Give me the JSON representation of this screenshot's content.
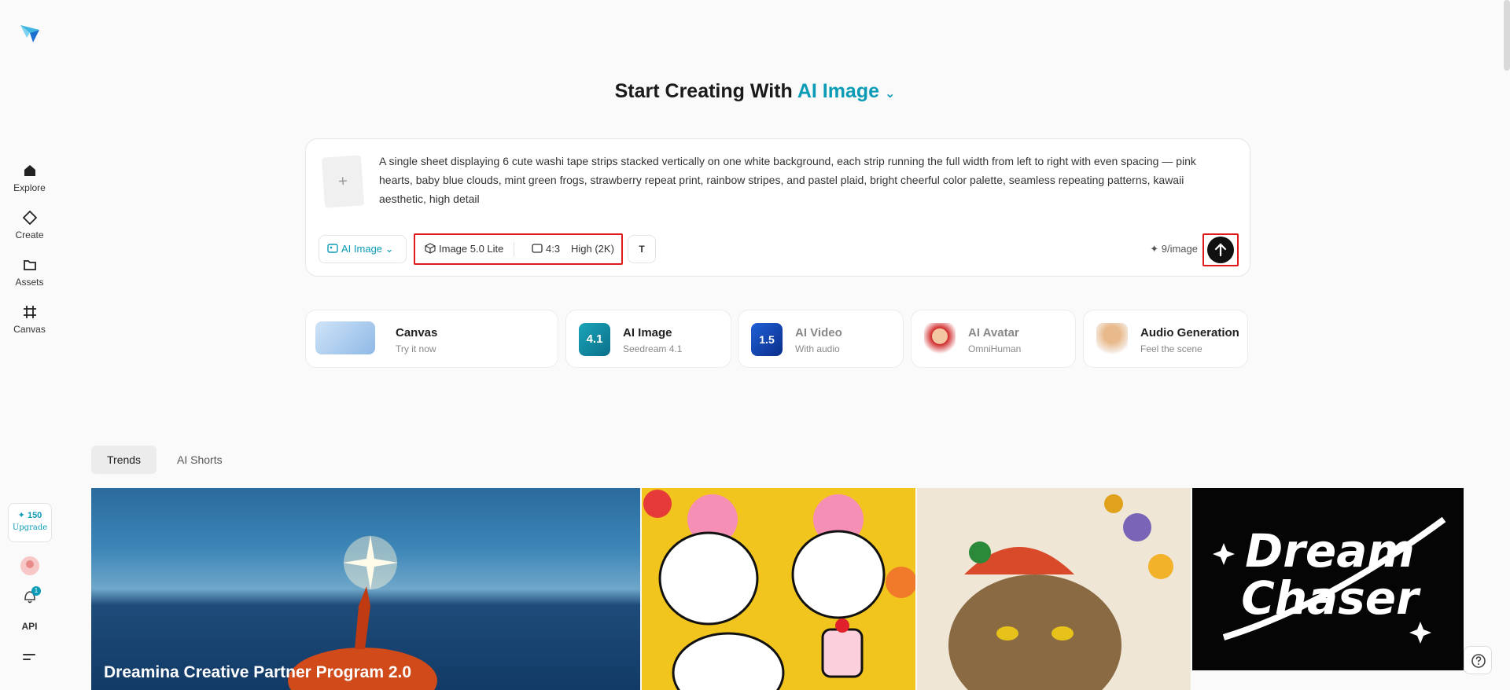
{
  "sidebar": {
    "items": [
      {
        "label": "Explore"
      },
      {
        "label": "Create"
      },
      {
        "label": "Assets"
      },
      {
        "label": "Canvas"
      }
    ],
    "credits": {
      "value": "✦ 150",
      "upgrade": "Upgrade"
    },
    "notification_count": "1",
    "api_label": "API"
  },
  "header": {
    "prefix": "Start Creating With ",
    "mode": "AI Image",
    "chevron": "⌄"
  },
  "prompt": {
    "add_symbol": "+",
    "text": "A single sheet displaying 6 cute washi tape strips stacked vertically on one white background, each strip running the full width from left to right with even spacing — pink hearts, baby blue clouds, mint green frogs, strawberry repeat print, rainbow stripes, and pastel plaid, bright cheerful color palette, seamless repeating patterns, kawaii aesthetic, high detail",
    "mode_chip": "AI Image",
    "model": "Image 5.0 Lite",
    "ratio": "4:3",
    "quality": "High (2K)",
    "text_tool": "T",
    "cost": "✦ 9/image"
  },
  "features": [
    {
      "title": "Canvas",
      "subtitle": "Try it now"
    },
    {
      "title": "AI Image",
      "subtitle": "Seedream 4.1"
    },
    {
      "title": "AI Video",
      "subtitle": "With audio"
    },
    {
      "title": "AI Avatar",
      "subtitle": "OmniHuman"
    },
    {
      "title": "Audio Generation",
      "subtitle": "Feel the scene"
    }
  ],
  "feature_badges": {
    "ai_image": "4.1",
    "ai_video": "1.5"
  },
  "tabs": [
    {
      "label": "Trends",
      "active": true
    },
    {
      "label": "AI Shorts",
      "active": false
    }
  ],
  "gallery": {
    "hero_title": "Dreamina Creative Partner Program 2.0",
    "poster_text_1": "Dream",
    "poster_text_2": "Chaser"
  },
  "colors": {
    "accent": "#0a9bb6",
    "highlight": "#e01a1a"
  }
}
